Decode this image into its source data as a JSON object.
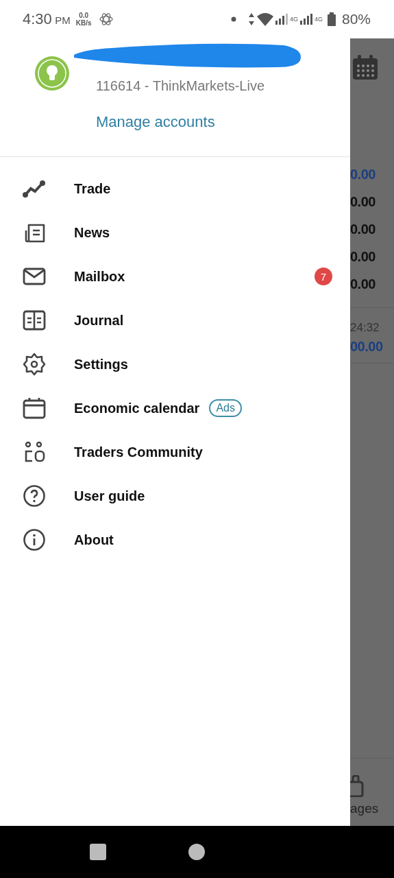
{
  "status_bar": {
    "time": "4:30",
    "ampm": "PM",
    "speed_value": "0.0",
    "speed_unit": "KB/s",
    "network_1": "4G",
    "network_2": "4G",
    "battery": "80%"
  },
  "drawer": {
    "account": "116614 - ThinkMarkets-Live",
    "manage_link": "Manage accounts",
    "items": [
      {
        "kind": "trade",
        "label": "Trade"
      },
      {
        "kind": "news",
        "label": "News"
      },
      {
        "kind": "mail",
        "label": "Mailbox",
        "badge": "7"
      },
      {
        "kind": "journal",
        "label": "Journal"
      },
      {
        "kind": "settings",
        "label": "Settings"
      },
      {
        "kind": "calendar",
        "label": "Economic calendar",
        "tag": "Ads"
      },
      {
        "kind": "community",
        "label": "Traders Community"
      },
      {
        "kind": "help",
        "label": "User guide"
      },
      {
        "kind": "info",
        "label": "About"
      }
    ]
  },
  "background": {
    "prices": [
      {
        "kind": "accent",
        "text": "0.00"
      },
      {
        "kind": "plain",
        "text": "0.00"
      },
      {
        "kind": "plain",
        "text": "0.00"
      },
      {
        "kind": "plain",
        "text": "0.00"
      },
      {
        "kind": "plain",
        "text": "0.00"
      }
    ],
    "time": "24:32",
    "total": "00.00",
    "nav_label": "ages"
  }
}
